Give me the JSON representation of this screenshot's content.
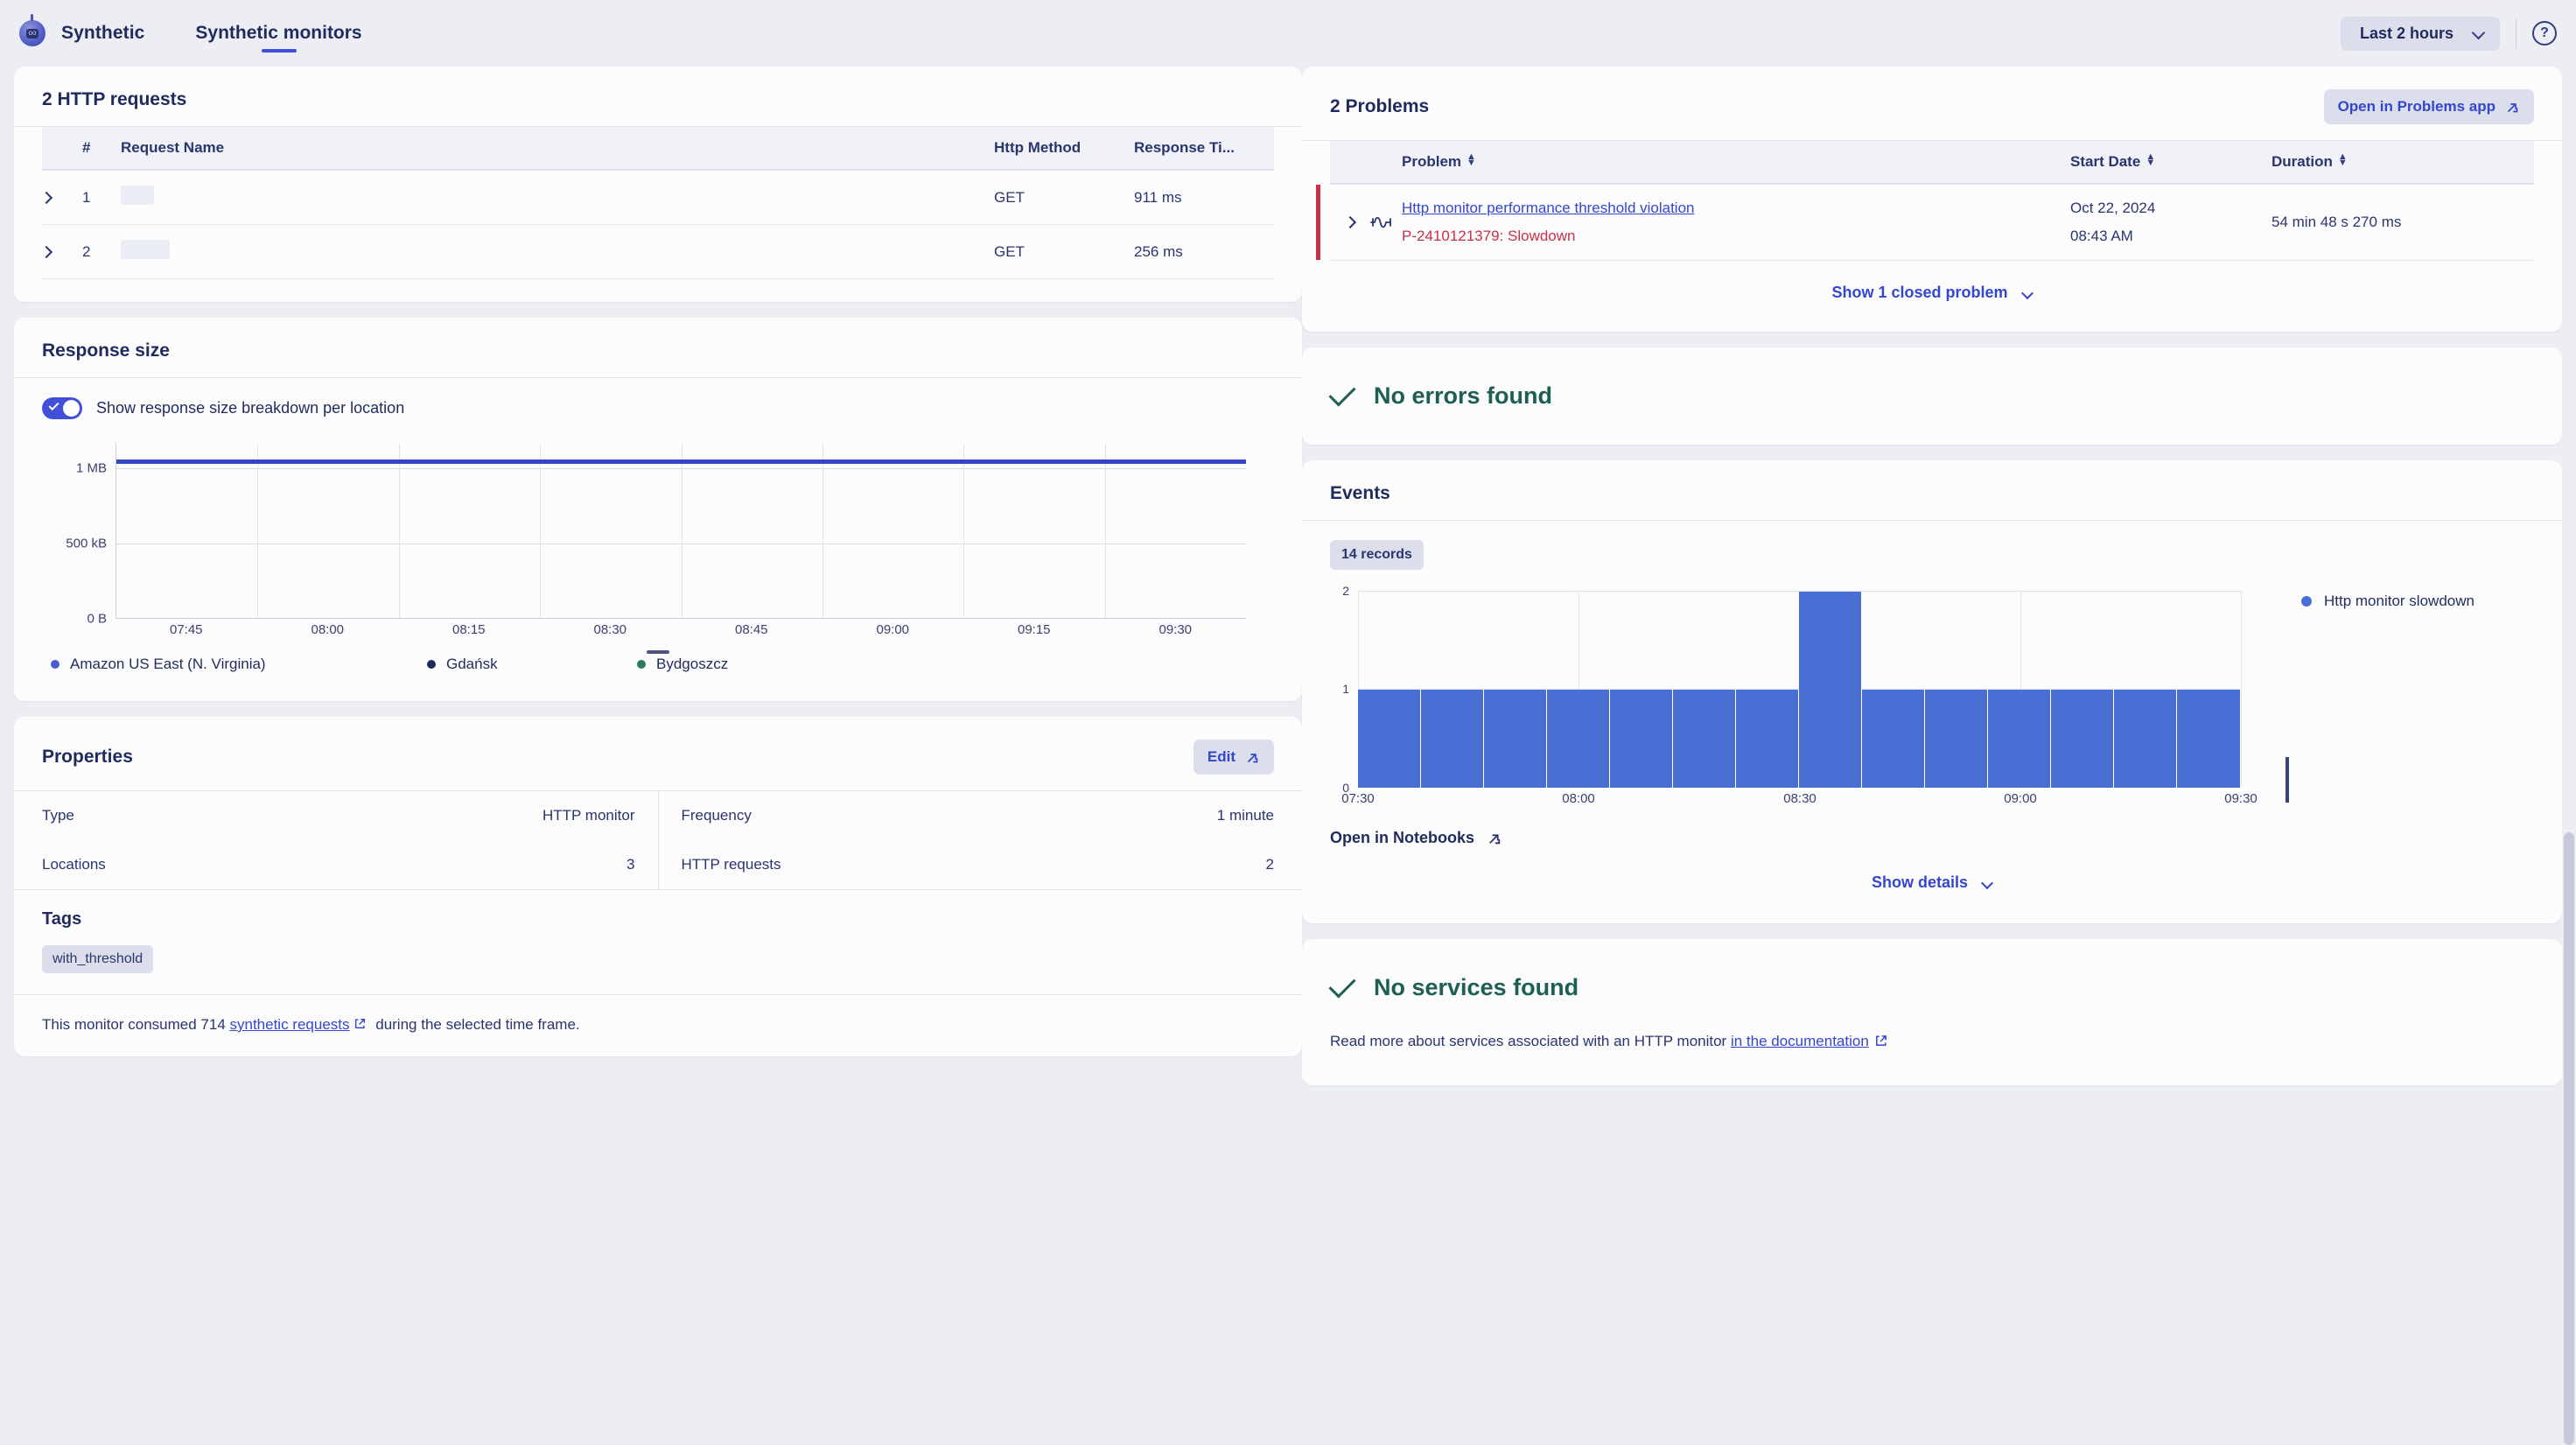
{
  "header": {
    "brand": "Synthetic",
    "tabs": [
      {
        "label": "Synthetic monitors",
        "active": true
      }
    ],
    "timeframe": "Last 2 hours",
    "help_icon": "question-mark-icon",
    "robot_face": "oo"
  },
  "http_requests": {
    "title": "2 HTTP requests",
    "columns": [
      "",
      "#",
      "Request Name",
      "Http Method",
      "Response Ti..."
    ],
    "rows": [
      {
        "index": "1",
        "name": "",
        "method": "GET",
        "response_time": "911 ms"
      },
      {
        "index": "2",
        "name": "",
        "method": "GET",
        "response_time": "256 ms"
      }
    ]
  },
  "response_size": {
    "title": "Response size",
    "toggle_label": "Show response size breakdown per location",
    "toggle_on": true,
    "legend": [
      {
        "label": "Amazon US East (N. Virginia)",
        "color": "#4a5bd4"
      },
      {
        "label": "Gdańsk",
        "color": "#1f2b5e"
      },
      {
        "label": "Bydgoszcz",
        "color": "#2d7a64"
      }
    ]
  },
  "properties": {
    "title": "Properties",
    "edit_label": "Edit",
    "left": [
      {
        "label": "Type",
        "value": "HTTP monitor"
      },
      {
        "label": "Locations",
        "value": "3"
      }
    ],
    "right": [
      {
        "label": "Frequency",
        "value": "1 minute"
      },
      {
        "label": "HTTP requests",
        "value": "2"
      }
    ],
    "tags_title": "Tags",
    "tags": [
      "with_threshold"
    ],
    "consumed_pre": "This monitor consumed 714 ",
    "consumed_link": "synthetic requests",
    "consumed_post": " during the selected time frame."
  },
  "problems": {
    "title": "2 Problems",
    "open_app_label": "Open in Problems app",
    "columns": [
      "Problem",
      "Start Date",
      "Duration"
    ],
    "rows": [
      {
        "title": "Http monitor performance threshold violation",
        "subtitle": "P-2410121379: Slowdown",
        "start_date": "Oct 22, 2024",
        "start_time": "08:43 AM",
        "duration": "54 min 48 s 270 ms",
        "severity_color": "#c9304a"
      }
    ],
    "show_closed": "Show 1 closed problem"
  },
  "errors": {
    "title": "No errors found"
  },
  "events": {
    "title": "Events",
    "records_badge": "14 records",
    "notebooks_label": "Open in Notebooks",
    "show_details": "Show details"
  },
  "services": {
    "title": "No services found",
    "text_pre": "Read more about services associated with an HTTP monitor ",
    "link": "in the documentation"
  },
  "chart_data": [
    {
      "type": "line",
      "title": "Response size",
      "xlabel": "",
      "ylabel": "",
      "x": [
        "07:45",
        "08:00",
        "08:15",
        "08:30",
        "08:45",
        "09:00",
        "09:15",
        "09:30"
      ],
      "ytick_labels": [
        "0 B",
        "500 kB",
        "1 MB"
      ],
      "ytick_values": [
        0,
        500000,
        1000000
      ],
      "ylim": [
        0,
        1150000
      ],
      "grid": true,
      "legend_position": "bottom",
      "series": [
        {
          "name": "Amazon US East (N. Virginia)",
          "color": "#4a5bd4",
          "value": 1060000
        },
        {
          "name": "Gdańsk",
          "color": "#1f2b5e",
          "value": 1060000
        },
        {
          "name": "Bydgoszcz",
          "color": "#2d7a64",
          "value": 1060000
        }
      ]
    },
    {
      "type": "bar",
      "title": "Events",
      "xlabel": "",
      "ylabel": "",
      "categories": [
        "07:30",
        "07:38",
        "07:45",
        "07:53",
        "08:00",
        "08:08",
        "08:15",
        "08:23",
        "08:30",
        "08:38",
        "08:45",
        "08:53",
        "09:00",
        "09:08"
      ],
      "xtick_labels": [
        "07:30",
        "08:00",
        "08:30",
        "09:00",
        "09:30"
      ],
      "values": [
        1,
        1,
        1,
        1,
        1,
        1,
        1,
        2,
        1,
        1,
        1,
        1,
        1,
        1
      ],
      "ytick_labels": [
        "0",
        "1",
        "2"
      ],
      "ylim": [
        0,
        2
      ],
      "grid": true,
      "legend_position": "right",
      "series": [
        {
          "name": "Http monitor slowdown",
          "color": "#4a6fd4"
        }
      ]
    }
  ]
}
